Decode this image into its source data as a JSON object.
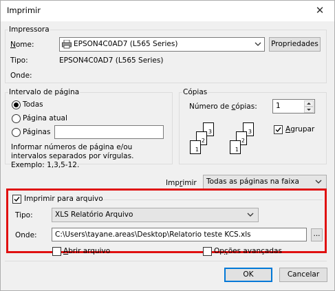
{
  "window": {
    "title": "Imprimir",
    "close_glyph": "✕"
  },
  "printer": {
    "group_label": "Impressora",
    "name_label": "Nome:",
    "name_value": "EPSON4C0AD7 (L565 Series)",
    "properties_button": "Propriedades",
    "type_label": "Tipo:",
    "type_value": "EPSON4C0AD7 (L565 Series)",
    "where_label": "Onde:"
  },
  "page_range": {
    "group_label": "Intervalo de página",
    "all": "Todas",
    "current": "Página atual",
    "pages": "Páginas",
    "pages_value": "",
    "hint": "Informar números de página e/ou intervalos separados por vírgulas. Exemplo: 1,3,5-12."
  },
  "copies": {
    "group_label": "Cópias",
    "count_label": "Número de cópias:",
    "count_value": "1",
    "collate_label": "Agrupar",
    "collate_checked": true,
    "stack_a": [
      "3",
      "2",
      "1"
    ],
    "stack_b": [
      "3",
      "2",
      "1"
    ]
  },
  "print_what": {
    "label": "Imprimir",
    "value": "Todas as páginas na faixa"
  },
  "print_to_file": {
    "label": "Imprimir para arquivo",
    "checked": true,
    "type_label": "Tipo:",
    "type_value": "XLS Relatório Arquivo",
    "where_label": "Onde:",
    "path_value": "C:\\Users\\tayane.areas\\Desktop\\Relatorio teste KCS.xls",
    "browse_button": "..."
  },
  "options": {
    "open_file": "Abrir arquivo",
    "advanced": "Opções avançadas"
  },
  "buttons": {
    "ok": "OK",
    "cancel": "Cancelar"
  },
  "colors": {
    "highlight": "#e01010",
    "accent": "#0078d7"
  },
  "icons": {
    "printer": "printer-icon",
    "dropdown": "chevron-down-icon"
  }
}
